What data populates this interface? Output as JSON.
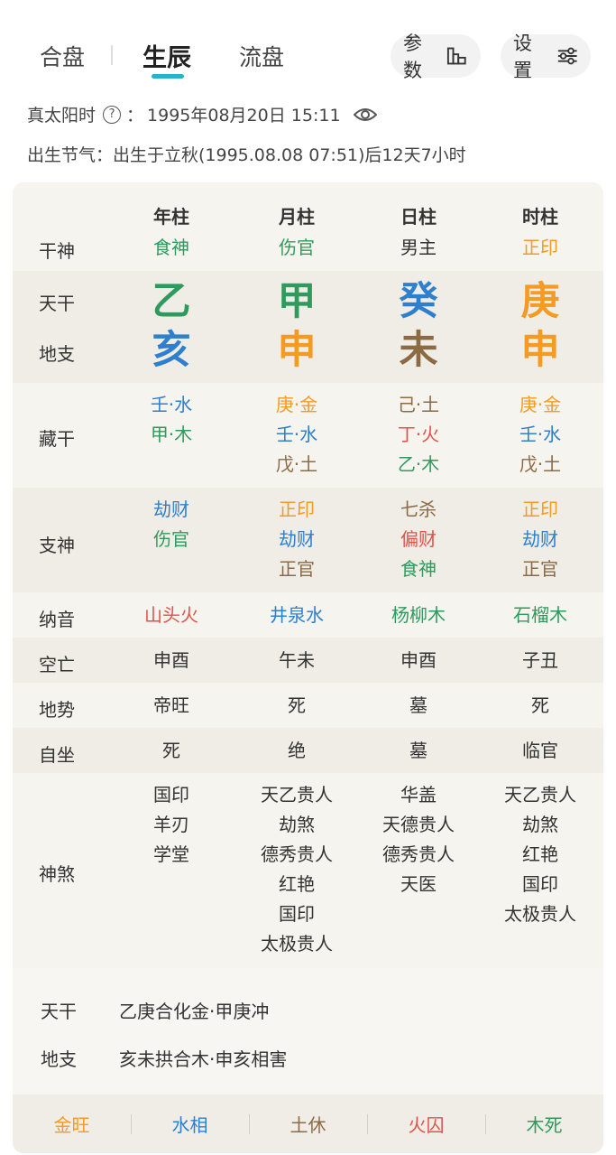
{
  "nav": {
    "tabs": [
      "合盘",
      "生辰",
      "流盘"
    ],
    "active_tab": "生辰",
    "params_label": "参数",
    "settings_label": "设置"
  },
  "solar_time": {
    "label": "真太阳时",
    "colon": "：",
    "value": "1995年08月20日 15:11"
  },
  "solar_term": "出生节气：出生于立秋(1995.08.08 07:51)后12天7小时",
  "chart": {
    "headers": [
      "年柱",
      "月柱",
      "日柱",
      "时柱"
    ],
    "row_labels": {
      "shishen": "干神",
      "tiangan": "天干",
      "dizhi": "地支",
      "canggan": "藏干",
      "zhishen": "支神",
      "nayin": "纳音",
      "kongwang": "空亡",
      "dishi": "地势",
      "zizuo": "自坐",
      "shensha": "神煞"
    },
    "shishen": [
      "食神",
      "伤官",
      "男主",
      "正印"
    ],
    "tiangan": [
      "乙",
      "甲",
      "癸",
      "庚"
    ],
    "dizhi": [
      "亥",
      "申",
      "未",
      "申"
    ],
    "canggan": [
      [
        "壬·水",
        "甲·木"
      ],
      [
        "庚·金",
        "壬·水",
        "戊·土"
      ],
      [
        "己·土",
        "丁·火",
        "乙·木"
      ],
      [
        "庚·金",
        "壬·水",
        "戊·土"
      ]
    ],
    "zhishen": [
      [
        "劫财",
        "伤官"
      ],
      [
        "正印",
        "劫财",
        "正官"
      ],
      [
        "七杀",
        "偏财",
        "食神"
      ],
      [
        "正印",
        "劫财",
        "正官"
      ]
    ],
    "nayin": [
      "山头火",
      "井泉水",
      "杨柳木",
      "石榴木"
    ],
    "kongwang": [
      "申酉",
      "午未",
      "申酉",
      "子丑"
    ],
    "dishi": [
      "帝旺",
      "死",
      "墓",
      "死"
    ],
    "zizuo": [
      "死",
      "绝",
      "墓",
      "临官"
    ],
    "shensha": [
      [
        "国印",
        "羊刃",
        "学堂"
      ],
      [
        "天乙贵人",
        "劫煞",
        "德秀贵人",
        "红艳",
        "国印",
        "太极贵人"
      ],
      [
        "华盖",
        "天德贵人",
        "德秀贵人",
        "天医"
      ],
      [
        "天乙贵人",
        "劫煞",
        "红艳",
        "国印",
        "太极贵人"
      ]
    ]
  },
  "relations": {
    "tiangan_label": "天干",
    "tiangan_value": "乙庚合化金·甲庚冲",
    "dizhi_label": "地支",
    "dizhi_value": "亥未拱合木·申亥相害"
  },
  "wuxing_state": [
    "金旺",
    "水相",
    "土休",
    "火囚",
    "木死"
  ],
  "colors": {
    "accent": "#27b3c9",
    "wood": "#2e9a5e",
    "water": "#2f7fcf",
    "metal": "#f59a23",
    "earth": "#8b6a44",
    "fire": "#e0524a"
  }
}
